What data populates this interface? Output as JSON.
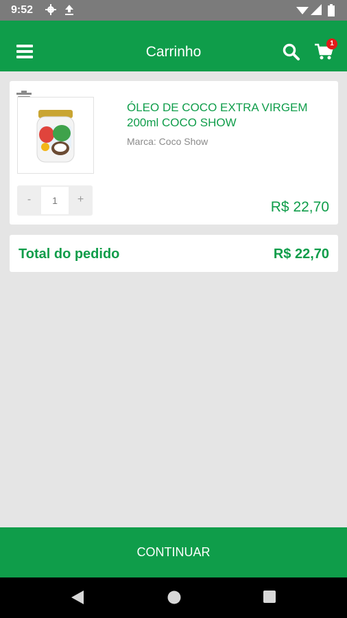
{
  "status_bar": {
    "time": "9:52",
    "icons": [
      "settings-icon",
      "upload-icon",
      "wifi-icon",
      "signal-icon",
      "battery-icon"
    ]
  },
  "app_bar": {
    "title": "Carrinho",
    "cart_badge": "1",
    "color": "#0f9d4a"
  },
  "cart_item": {
    "name": "ÓLEO DE COCO EXTRA VIRGEM 200ml COCO SHOW",
    "brand": "Marca: Coco Show",
    "quantity": "1",
    "minus_label": "-",
    "plus_label": "+",
    "price": "R$ 22,70"
  },
  "total": {
    "label": "Total do pedido",
    "value": "R$ 22,70"
  },
  "continue_button": {
    "label": "CONTINUAR"
  }
}
